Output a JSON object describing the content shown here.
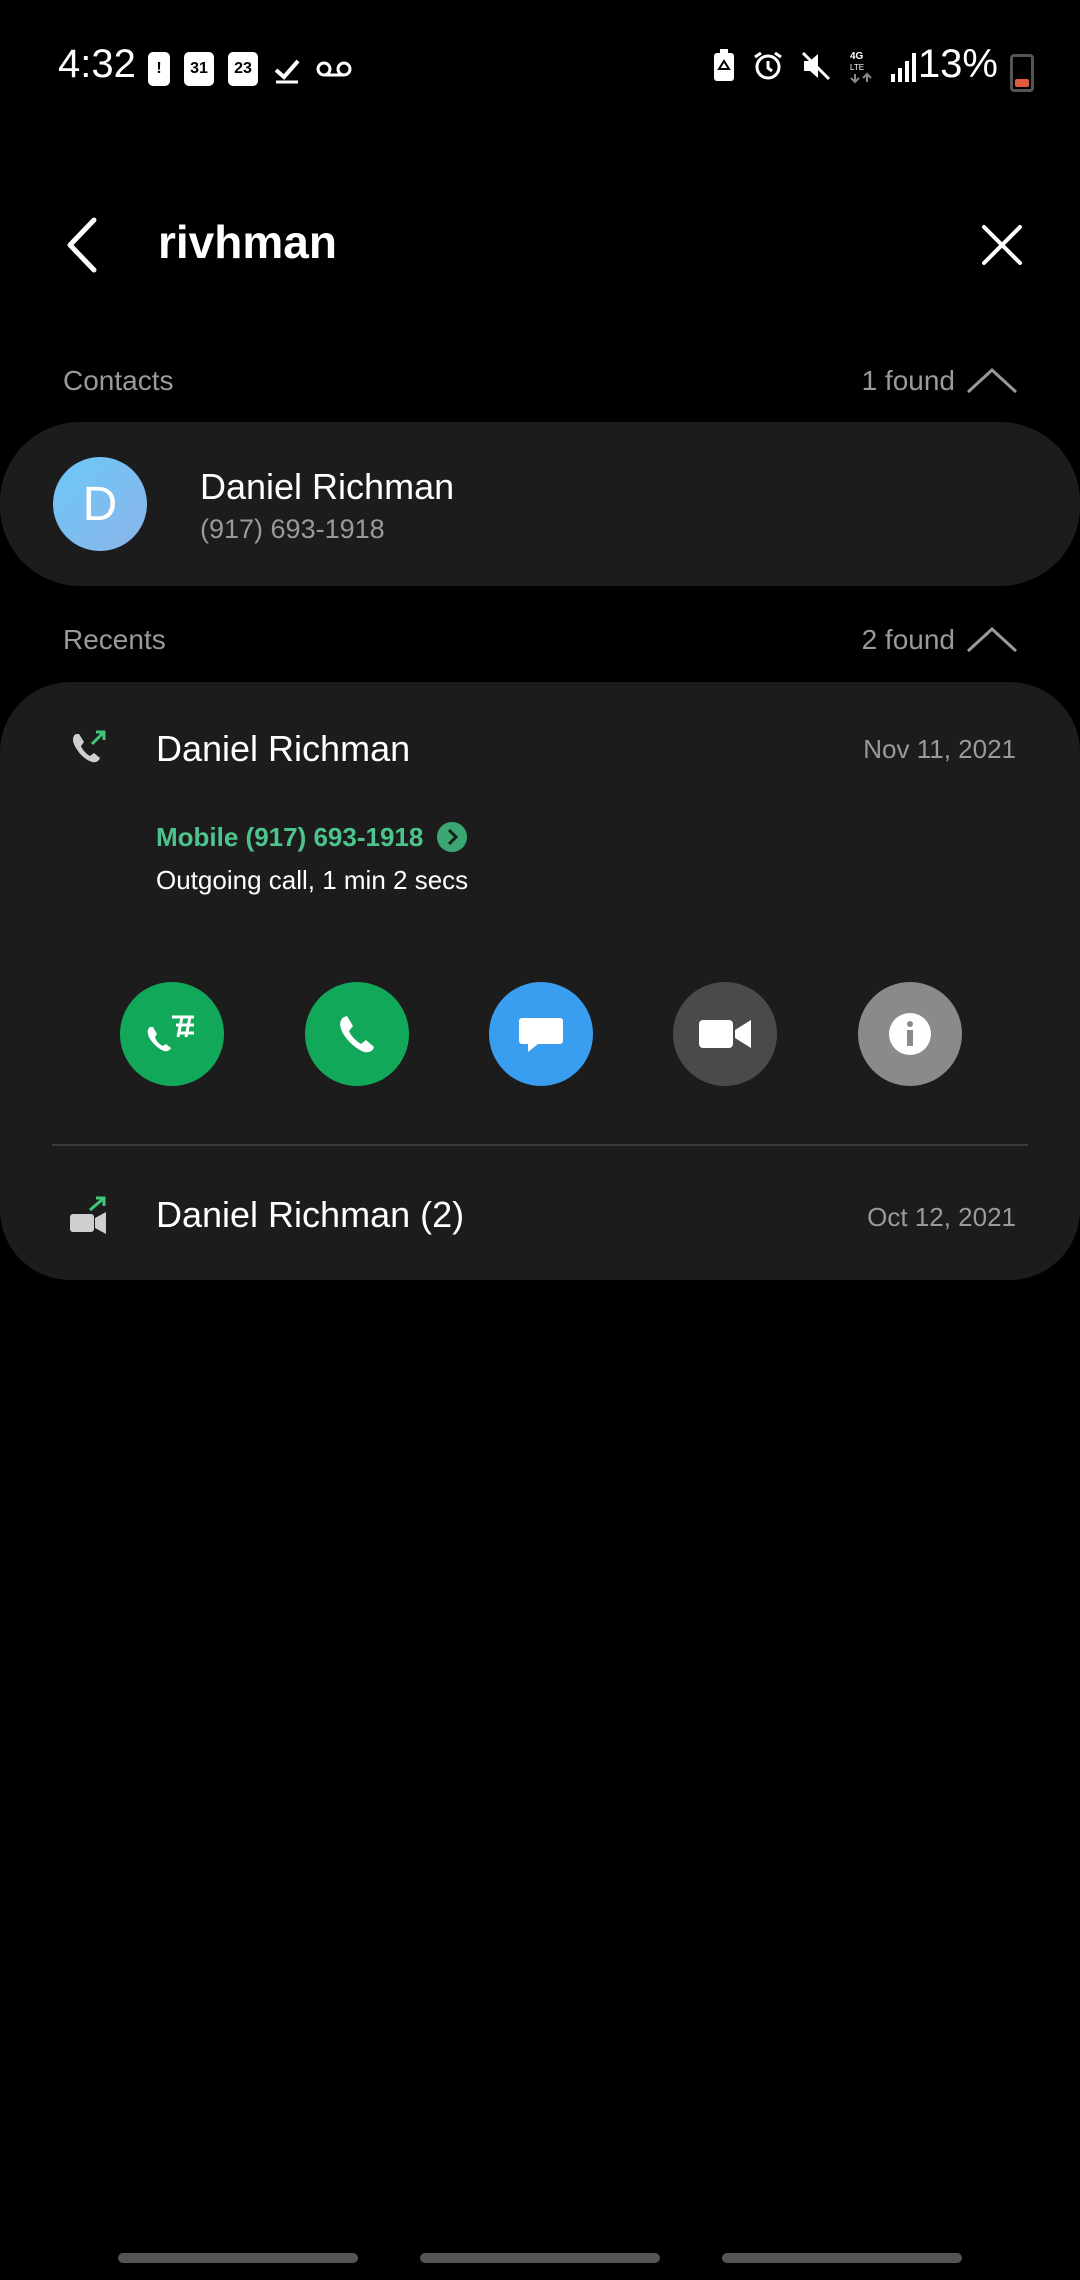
{
  "status_bar": {
    "time": "4:32",
    "left_icons": [
      "alert-icon",
      "calendar-31-icon",
      "calendar-23-icon",
      "check-icon",
      "voicemail-icon"
    ],
    "calendar_31": "31",
    "calendar_23": "23",
    "right_icons": [
      "battery-saver-icon",
      "alarm-icon",
      "mute-icon",
      "4g-lte-icon",
      "signal-icon"
    ],
    "network": "4G LTE",
    "battery_percent": "13%"
  },
  "search": {
    "query": "rivhman"
  },
  "contacts": {
    "label": "Contacts",
    "count": "1 found",
    "items": [
      {
        "initial": "D",
        "name": "Daniel Richman",
        "phone": "(917) 693-1918"
      }
    ]
  },
  "recents": {
    "label": "Recents",
    "count": "2 found",
    "items": [
      {
        "name": "Daniel Richman",
        "date": "Nov 11, 2021",
        "number_line": "Mobile (917) 693-1918",
        "detail": "Outgoing call, 1 min 2 secs",
        "type_icon": "outgoing-call-icon"
      },
      {
        "name": "Daniel Richman (2)",
        "date": "Oct 12, 2021",
        "type_icon": "outgoing-video-call-icon"
      }
    ],
    "actions": [
      "rtt-call-icon",
      "call-icon",
      "message-icon",
      "video-call-icon",
      "info-icon"
    ]
  },
  "colors": {
    "accent_green": "#12a85a",
    "message_blue": "#3a9ef0",
    "number_green": "#4cc48c",
    "card_bg": "#1c1c1c"
  }
}
